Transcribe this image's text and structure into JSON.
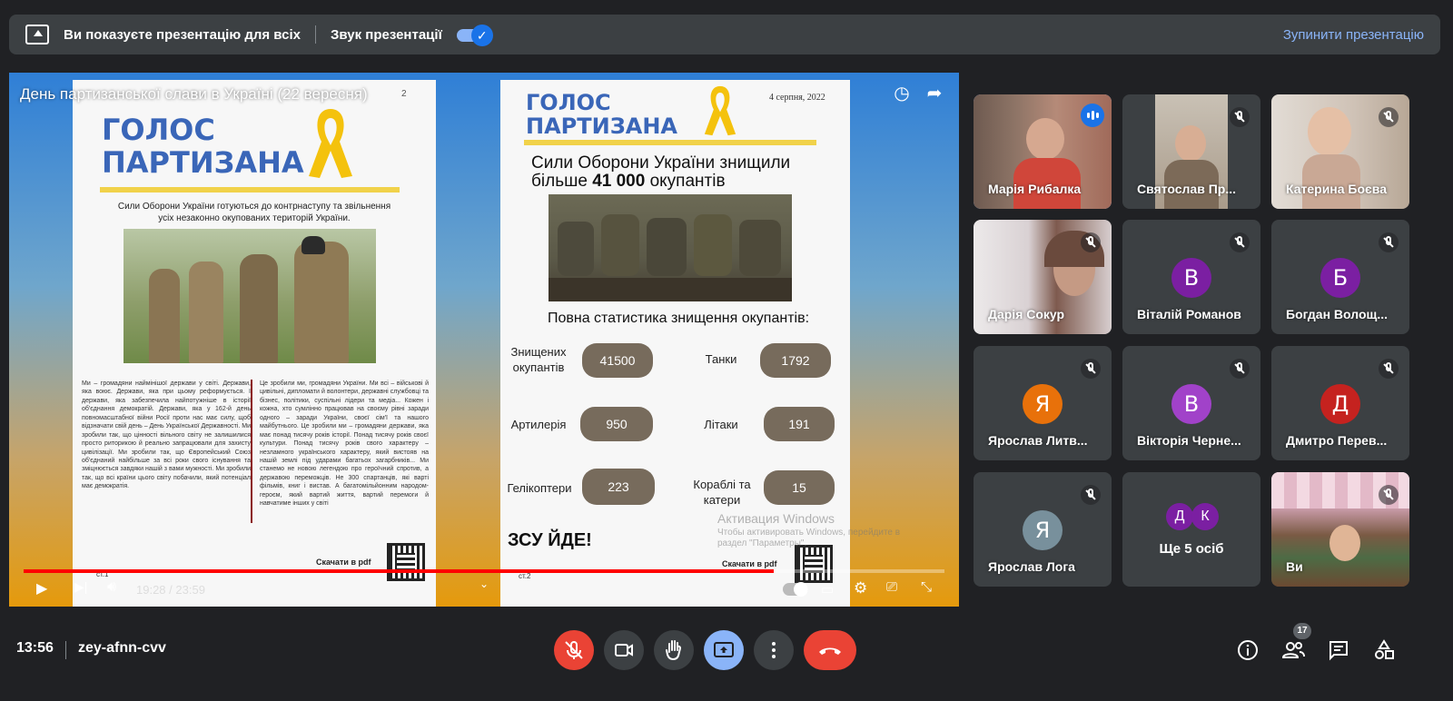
{
  "banner": {
    "presenting_text": "Ви показуєте презентацію для всіх",
    "sound_label": "Звук презентації",
    "stop_label": "Зупинити презентацію"
  },
  "video": {
    "title": "День партизанської слави в Україні (22 вересня)",
    "time_current": "19:28",
    "time_separator": "/",
    "time_total": "23:59",
    "progress_fraction": 0.815,
    "page1": {
      "logo_line1": "ГОЛОС",
      "logo_line2": "ПАРТИЗАНА",
      "page_num_top": "2",
      "intro": "Сили Оборони України готуються до контрнаступу та звільнення усіх незаконно окупованих територій України.",
      "col1": "Ми – громадяни наймінішої держави у світі. Держави, яка воює. Держави, яка при цьому реформується. І держави, яка забезпечила найпотужніше в історії об'єднання демократій. Держави, яка у 162-й день повномасштабної війни Росії проти нас має силу, щоб відзначати свій день – День Української Державності. Ми зробили так, що цінності вільного світу не залишилися просто риторикою й реально запрацювали для захисту цивілізації. Ми зробили так, що Європейський Союз об'єднаний найбільше за всі роки свого існування та зміцнюється завдяки нашій з вами мужності. Ми зробили так, що всі країни цього світу побачили, який потенціал має демократія.",
      "col2": "Це зробили ми, громадяни України. Ми всі – військові й цивільні, дипломати й волонтери, державні службовці та бізнес, політики, суспільні лідери та медіа... Кожен і кожна, хто сумлінно працював на своєму рівні заради одного – заради України, своєї сім'ї та нашого майбутнього. Це зробили ми – громадяни держави, яка має понад тисячу років історії. Понад тисячу років своєї культури. Понад тисячу років свого характеру – незламного українського характеру, який вистояв на нашій землі під ударами багатьох загарбників... Ми станемо не новою легендою про героїчний спротив, а державою переможців. Не 300 спартанців, які варті фільмів, книг і вистав. А багатомільйонним народом-героєм, який вартий життя, вартий перемоги й навчатиме інших у світі",
      "download": "Скачати в pdf",
      "footer": "ст.1"
    },
    "page2": {
      "logo_line1": "ГОЛОС",
      "logo_line2": "ПАРТИЗАНА",
      "date": "4 серпня, 2022",
      "headline_line1": "Сили Оборони України знищили",
      "headline_line2_a": "більше",
      "headline_line2_b": "41 000",
      "headline_line2_c": "окупантів",
      "stats_title": "Повна статистика знищення окупантів:",
      "stats": [
        {
          "label": "Знищених окупантів",
          "value": "41500"
        },
        {
          "label": "Танки",
          "value": "1792"
        },
        {
          "label": "Артилерія",
          "value": "950"
        },
        {
          "label": "Літаки",
          "value": "191"
        },
        {
          "label": "Гелікоптери",
          "value": "223"
        },
        {
          "label": "Кораблі та катери",
          "value": "15"
        }
      ],
      "slogan": "ЗСУ ЙДЕ!",
      "download": "Скачати в pdf",
      "footer": "ст.2"
    },
    "watermark": {
      "line1": "Активация Windows",
      "line2": "Чтобы активировать Windows, перейдите в",
      "line3": "раздел \"Параметры\"."
    }
  },
  "participants": [
    {
      "name": "Марія Рибалка",
      "speaking": true
    },
    {
      "name": "Святослав Пр...",
      "muted": true
    },
    {
      "name": "Катерина Боєва",
      "muted": true
    },
    {
      "name": "Дарія Сокур",
      "muted": true
    },
    {
      "name": "Віталій Романов",
      "initial": "В",
      "color": "#7b1fa2",
      "muted": true
    },
    {
      "name": "Богдан Волощ...",
      "initial": "Б",
      "color": "#7b1fa2",
      "muted": true
    },
    {
      "name": "Ярослав Литв...",
      "initial": "Я",
      "color": "#e8710a",
      "muted": true
    },
    {
      "name": "Вікторія Черне...",
      "initial": "В",
      "color": "#a142c9",
      "muted": true
    },
    {
      "name": "Дмитро Перев...",
      "initial": "Д",
      "color": "#c5221f",
      "muted": true
    },
    {
      "name": "Ярослав Лога",
      "initial": "Я",
      "color": "#78909c",
      "muted": true
    },
    {
      "name": "Ще 5 осіб",
      "mini": [
        "Д",
        "К"
      ]
    },
    {
      "name": "Ви",
      "muted": true
    }
  ],
  "bottom": {
    "time": "13:56",
    "meeting_code": "zey-afnn-cvv",
    "participants_count": "17"
  },
  "colors": {
    "accent_blue": "#8ab4f8",
    "end_call_red": "#ea4335",
    "progress_red": "#ff0000"
  }
}
